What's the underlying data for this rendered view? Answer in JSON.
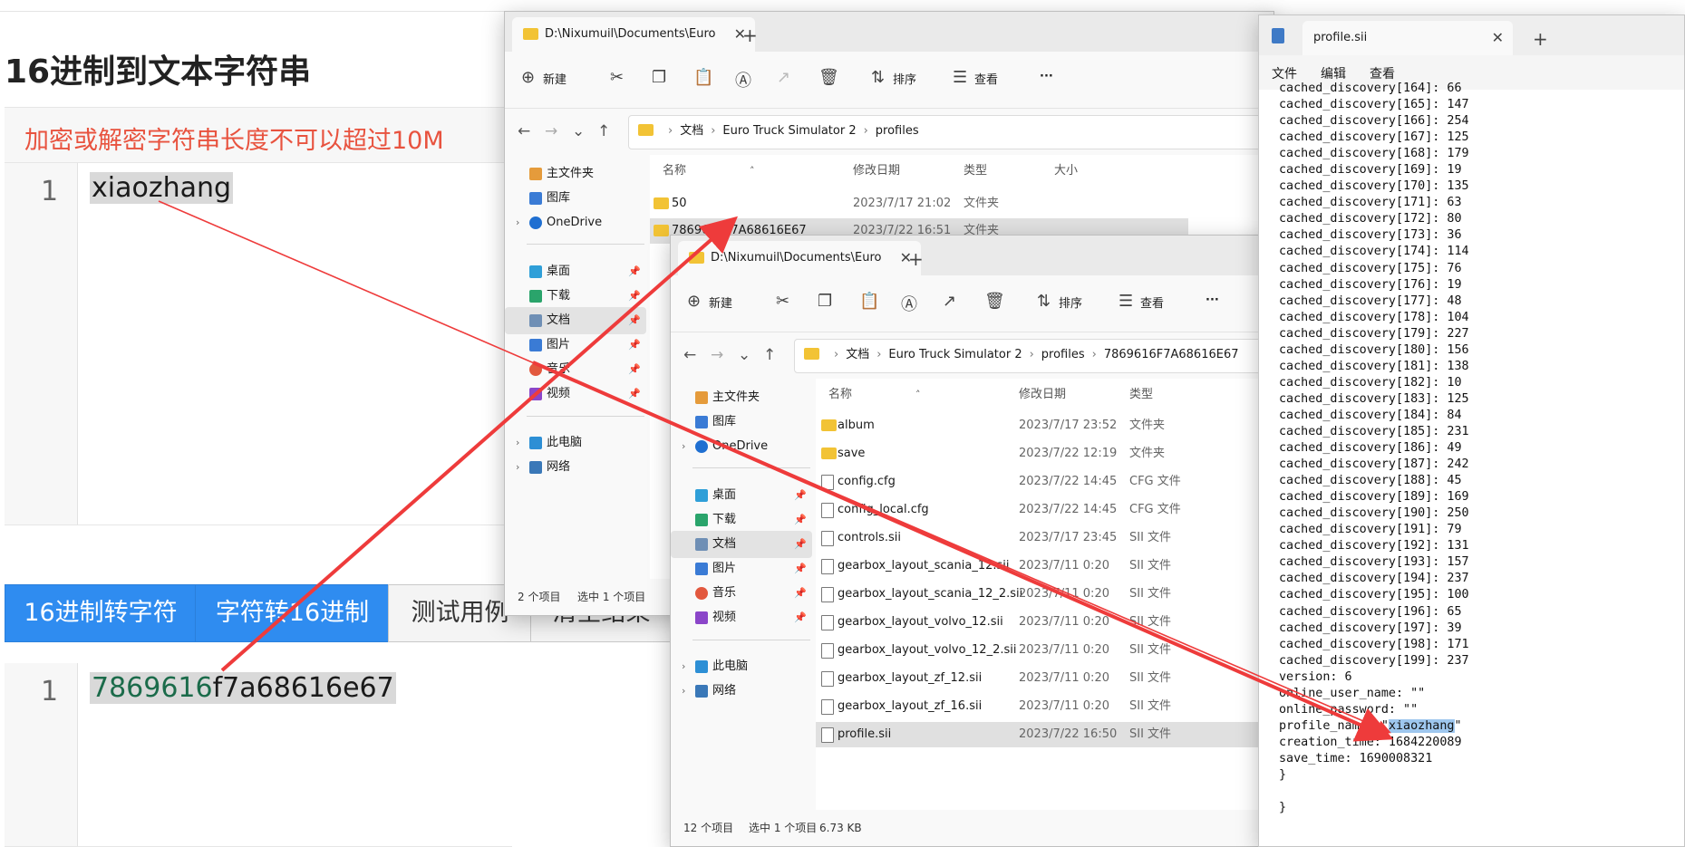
{
  "converter": {
    "title": "16进制到文本字符串",
    "warning": "加密或解密字符串长度不可以超过10M",
    "input": {
      "line": "1",
      "text": "xiaozhang"
    },
    "buttons": [
      "16进制转字符",
      "字符转16进制",
      "测试用例",
      "清空结果"
    ],
    "output": {
      "line": "1",
      "hex_prefix": "7869616",
      "hex_rest": "f7a68616e67"
    }
  },
  "explorer1": {
    "tab_title": "D:\\Nixumuil\\Documents\\Euro",
    "toolbar": {
      "new": "新建",
      "sort": "排序",
      "view": "查看",
      "more": "···"
    },
    "breadcrumb": [
      "文档",
      "Euro Truck Simulator 2",
      "profiles"
    ],
    "nav": [
      "主文件夹",
      "图库",
      "OneDrive",
      "桌面",
      "下载",
      "文档",
      "图片",
      "音乐",
      "视频",
      "此电脑",
      "网络"
    ],
    "headers": {
      "name": "名称",
      "date": "修改日期",
      "type": "类型",
      "size": "大小"
    },
    "rows": [
      {
        "name": "50",
        "date": "2023/7/17 21:02",
        "type": "文件夹"
      },
      {
        "name": "7869616F7A68616E67",
        "date": "2023/7/22 16:51",
        "type": "文件夹"
      }
    ],
    "status": {
      "count": "2 个项目",
      "selected": "选中 1 个项目"
    }
  },
  "explorer2": {
    "tab_title": "D:\\Nixumuil\\Documents\\Euro",
    "toolbar": {
      "new": "新建",
      "sort": "排序",
      "view": "查看",
      "more": "···"
    },
    "breadcrumb": [
      "文档",
      "Euro Truck Simulator 2",
      "profiles",
      "7869616F7A68616E67"
    ],
    "nav": [
      "主文件夹",
      "图库",
      "OneDrive",
      "桌面",
      "下载",
      "文档",
      "图片",
      "音乐",
      "视频",
      "此电脑",
      "网络"
    ],
    "headers": {
      "name": "名称",
      "date": "修改日期",
      "type": "类型"
    },
    "rows": [
      {
        "name": "album",
        "date": "2023/7/17 23:52",
        "type": "文件夹",
        "kind": "folder"
      },
      {
        "name": "save",
        "date": "2023/7/22 12:19",
        "type": "文件夹",
        "kind": "folder"
      },
      {
        "name": "config.cfg",
        "date": "2023/7/22 14:45",
        "type": "CFG 文件",
        "kind": "file"
      },
      {
        "name": "config_local.cfg",
        "date": "2023/7/22 14:45",
        "type": "CFG 文件",
        "kind": "file"
      },
      {
        "name": "controls.sii",
        "date": "2023/7/17 23:45",
        "type": "SII 文件",
        "kind": "file"
      },
      {
        "name": "gearbox_layout_scania_12.sii",
        "date": "2023/7/11 0:20",
        "type": "SII 文件",
        "kind": "file"
      },
      {
        "name": "gearbox_layout_scania_12_2.sii",
        "date": "2023/7/11 0:20",
        "type": "SII 文件",
        "kind": "file"
      },
      {
        "name": "gearbox_layout_volvo_12.sii",
        "date": "2023/7/11 0:20",
        "type": "SII 文件",
        "kind": "file"
      },
      {
        "name": "gearbox_layout_volvo_12_2.sii",
        "date": "2023/7/11 0:20",
        "type": "SII 文件",
        "kind": "file"
      },
      {
        "name": "gearbox_layout_zf_12.sii",
        "date": "2023/7/11 0:20",
        "type": "SII 文件",
        "kind": "file"
      },
      {
        "name": "gearbox_layout_zf_16.sii",
        "date": "2023/7/11 0:20",
        "type": "SII 文件",
        "kind": "file"
      },
      {
        "name": "profile.sii",
        "date": "2023/7/22 16:50",
        "type": "SII 文件",
        "kind": "file"
      }
    ],
    "status": {
      "count": "12 个项目",
      "selected": "选中 1 个项目",
      "size": "6.73 KB"
    }
  },
  "notepad": {
    "tab_title": "profile.sii",
    "menu": [
      "文件",
      "编辑",
      "查看"
    ],
    "lines": [
      "cached_discovery[164]: 66",
      "cached_discovery[165]: 147",
      "cached_discovery[166]: 254",
      "cached_discovery[167]: 125",
      "cached_discovery[168]: 179",
      "cached_discovery[169]: 19",
      "cached_discovery[170]: 135",
      "cached_discovery[171]: 63",
      "cached_discovery[172]: 80",
      "cached_discovery[173]: 36",
      "cached_discovery[174]: 114",
      "cached_discovery[175]: 76",
      "cached_discovery[176]: 19",
      "cached_discovery[177]: 48",
      "cached_discovery[178]: 104",
      "cached_discovery[179]: 227",
      "cached_discovery[180]: 156",
      "cached_discovery[181]: 138",
      "cached_discovery[182]: 10",
      "cached_discovery[183]: 125",
      "cached_discovery[184]: 84",
      "cached_discovery[185]: 231",
      "cached_discovery[186]: 49",
      "cached_discovery[187]: 242",
      "cached_discovery[188]: 45",
      "cached_discovery[189]: 169",
      "cached_discovery[190]: 250",
      "cached_discovery[191]: 79",
      "cached_discovery[192]: 131",
      "cached_discovery[193]: 157",
      "cached_discovery[194]: 237",
      "cached_discovery[195]: 100",
      "cached_discovery[196]: 65",
      "cached_discovery[197]: 39",
      "cached_discovery[198]: 171",
      "cached_discovery[199]: 237",
      "version: 6",
      "online_user_name: \"\"",
      "online_password: \"\""
    ],
    "profile_key": "profile_name: \"",
    "profile_value": "xiaozhang",
    "profile_end": "\"",
    "tail_lines": [
      "creation_time: 1684220089",
      "save_time: 1690008321",
      "}",
      "",
      "}"
    ]
  },
  "colors": {
    "accent": "#2f8cf0",
    "warning": "#e8533f",
    "arrow": "#ee3b3b",
    "folder": "#f2c335"
  }
}
